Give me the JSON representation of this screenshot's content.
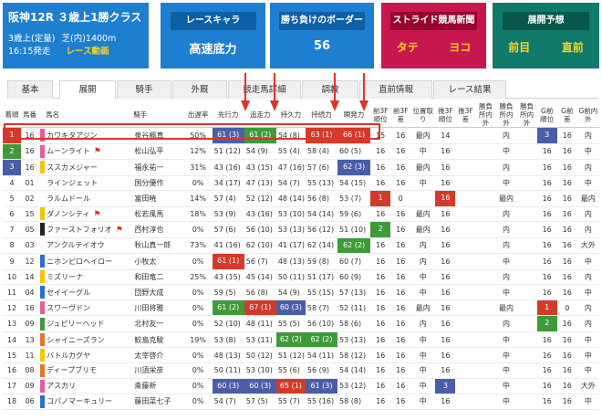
{
  "race_info": {
    "title": "阪神12R ３歳上1勝クラス",
    "condition": "3歳上(定量)",
    "course": "芝(内)1400m",
    "time": "16:15発走",
    "video": "レース動画"
  },
  "boxes": {
    "race_chara": {
      "caption": "レースキャラ",
      "value": "高速底力"
    },
    "border": {
      "caption": "勝ち負けのボーダー",
      "value": "56"
    },
    "stride": {
      "caption": "ストライド競馬新聞",
      "a": "タテ",
      "b": "ヨコ"
    },
    "forecast": {
      "caption": "展開予想",
      "a": "前目",
      "b": "直前"
    }
  },
  "tabs": [
    "基本",
    "展開",
    "騎手",
    "外厩",
    "競走馬詳細",
    "調教",
    "直前情報",
    "レース結果"
  ],
  "active_tab": "展開",
  "headers": [
    "着順",
    "馬番",
    "",
    "馬名",
    "騎手",
    "出遅率",
    "先行力",
    "追走力",
    "持久力",
    "持続力",
    "瞬発力",
    "前3F順位",
    "前3F差",
    "位置取り",
    "後3F順位",
    "後3F差",
    "勝負所内外",
    "勝負所内外",
    "勝負所内外",
    "G前順位",
    "G前差",
    "G前内外"
  ],
  "colors": {
    "red": "#d23b2a",
    "green": "#3f9a3c",
    "blue": "#4a5ea8",
    "highlight": "#e0322b"
  },
  "rows": [
    {
      "rank": "1",
      "rank_color": "red",
      "num": "16",
      "band": "#e85a9a",
      "name": "カワキタアジン",
      "flag": "",
      "jockey": "泉谷楓真",
      "delay": "50%",
      "s": [
        [
          "61 (3)",
          "bl"
        ],
        [
          "61 (2)",
          "gr"
        ],
        [
          "54 (8)",
          ""
        ],
        [
          "63 (1)",
          "rd"
        ],
        [
          "66 (1)",
          "rd"
        ]
      ],
      "f3o": "15",
      "f3d": "16",
      "pos": "最内",
      "l3o": "14",
      "l3d": "",
      "o1": "",
      "o2": "内",
      "o3": "",
      "go": [
        "3",
        "bl"
      ],
      "gd": "16",
      "gi": "内"
    },
    {
      "rank": "2",
      "rank_color": "green",
      "num": "16",
      "band": "#e85a9a",
      "name": "ムーンライト",
      "flag": "⚑",
      "jockey": "松山弘平",
      "delay": "12%",
      "s": [
        [
          "51 (12)",
          ""
        ],
        [
          "54 (9)",
          ""
        ],
        [
          "55 (4)",
          ""
        ],
        [
          "58 (4)",
          ""
        ],
        [
          "60 (5)",
          ""
        ]
      ],
      "f3o": "16",
      "f3d": "16",
      "pos": "中",
      "l3o": "16",
      "l3d": "",
      "o1": "",
      "o2": "中",
      "o3": "",
      "go": [
        "16",
        ""
      ],
      "gd": "16",
      "gi": "中"
    },
    {
      "rank": "3",
      "rank_color": "blue",
      "num": "16",
      "band": "#f3c400",
      "name": "ススカメジャー",
      "flag": "",
      "jockey": "福永祐一",
      "delay": "31%",
      "s": [
        [
          "43 (16)",
          ""
        ],
        [
          "43 (15)",
          ""
        ],
        [
          "47 (16)",
          ""
        ],
        [
          "57 (6)",
          ""
        ],
        [
          "62 (3)",
          "bl"
        ]
      ],
      "f3o": "16",
      "f3d": "16",
      "pos": "最内",
      "l3o": "16",
      "l3d": "",
      "o1": "",
      "o2": "内",
      "o3": "",
      "go": [
        "16",
        ""
      ],
      "gd": "16",
      "gi": "内"
    },
    {
      "rank": "4",
      "rank_color": "",
      "num": "01",
      "band": "#ffffff",
      "name": "ラインジェット",
      "flag": "",
      "jockey": "国分優作",
      "delay": "0%",
      "s": [
        [
          "34 (17)",
          ""
        ],
        [
          "47 (13)",
          ""
        ],
        [
          "54 (7)",
          ""
        ],
        [
          "55 (13)",
          ""
        ],
        [
          "54 (15)",
          ""
        ]
      ],
      "f3o": "16",
      "f3d": "16",
      "pos": "中",
      "l3o": "16",
      "l3d": "",
      "o1": "",
      "o2": "中",
      "o3": "",
      "go": [
        "16",
        ""
      ],
      "gd": "16",
      "gi": "中"
    },
    {
      "rank": "5",
      "rank_color": "",
      "num": "02",
      "band": "#ffffff",
      "name": "ラルムドール",
      "flag": "",
      "jockey": "富田暁",
      "delay": "14%",
      "s": [
        [
          "57 (4)",
          ""
        ],
        [
          "52 (12)",
          ""
        ],
        [
          "48 (14)",
          ""
        ],
        [
          "56 (8)",
          ""
        ],
        [
          "53 (7)",
          ""
        ]
      ],
      "f3o": [
        "1",
        "rd"
      ],
      "f3d": "0",
      "pos": "",
      "l3o": [
        "16",
        "rd"
      ],
      "l3d": "",
      "o1": "",
      "o2": "最内",
      "o3": "",
      "go": [
        "16",
        ""
      ],
      "gd": "16",
      "gi": "最内"
    },
    {
      "rank": "6",
      "rank_color": "",
      "num": "15",
      "band": "#f3c400",
      "name": "ダノンシティ",
      "flag": "⚑",
      "jockey": "松若風馬",
      "delay": "18%",
      "s": [
        [
          "53 (9)",
          ""
        ],
        [
          "43 (16)",
          ""
        ],
        [
          "53 (10)",
          ""
        ],
        [
          "54 (14)",
          ""
        ],
        [
          "59 (6)",
          ""
        ]
      ],
      "f3o": "16",
      "f3d": "16",
      "pos": "最内",
      "l3o": "16",
      "l3d": "",
      "o1": "",
      "o2": "内",
      "o3": "",
      "go": [
        "16",
        ""
      ],
      "gd": "16",
      "gi": "内"
    },
    {
      "rank": "7",
      "rank_color": "",
      "num": "05",
      "band": "#222222",
      "name": "ファーストフォリオ",
      "flag": "⚑",
      "jockey": "西村淳也",
      "delay": "0%",
      "s": [
        [
          "57 (6)",
          ""
        ],
        [
          "56 (10)",
          ""
        ],
        [
          "53 (13)",
          ""
        ],
        [
          "56 (12)",
          ""
        ],
        [
          "51 (10)",
          ""
        ]
      ],
      "f3o": [
        "2",
        "gr"
      ],
      "f3d": "16",
      "pos": "最内",
      "l3o": "16",
      "l3d": "",
      "o1": "",
      "o2": "内",
      "o3": "",
      "go": [
        "16",
        ""
      ],
      "gd": "16",
      "gi": "内"
    },
    {
      "rank": "8",
      "rank_color": "",
      "num": "03",
      "band": "#ffffff",
      "name": "アンクルテイオウ",
      "flag": "",
      "jockey": "秋山真一郎",
      "delay": "73%",
      "s": [
        [
          "41 (16)",
          ""
        ],
        [
          "62 (10)",
          ""
        ],
        [
          "41 (17)",
          ""
        ],
        [
          "62 (14)",
          ""
        ],
        [
          "62 (2)",
          "gr"
        ]
      ],
      "f3o": "16",
      "f3d": "16",
      "pos": "内",
      "l3o": "16",
      "l3d": "",
      "o1": "",
      "o2": "内",
      "o3": "",
      "go": [
        "16",
        ""
      ],
      "gd": "16",
      "gi": "大外"
    },
    {
      "rank": "9",
      "rank_color": "",
      "num": "12",
      "band": "#2a6ed0",
      "name": "ニホンピロヘイロー",
      "flag": "",
      "jockey": "小牧太",
      "delay": "0%",
      "s": [
        [
          "61 (1)",
          "rd"
        ],
        [
          "56 (7)",
          ""
        ],
        [
          "48 (13)",
          ""
        ],
        [
          "59 (8)",
          ""
        ],
        [
          "60 (7)",
          ""
        ]
      ],
      "f3o": "16",
      "f3d": "16",
      "pos": "内",
      "l3o": "16",
      "l3d": "",
      "o1": "",
      "o2": "中",
      "o3": "",
      "go": [
        "16",
        ""
      ],
      "gd": "16",
      "gi": "中"
    },
    {
      "rank": "10",
      "rank_color": "",
      "num": "14",
      "band": "#f3c400",
      "name": "ミズリーナ",
      "flag": "",
      "jockey": "和田竜二",
      "delay": "25%",
      "s": [
        [
          "43 (15)",
          ""
        ],
        [
          "45 (14)",
          ""
        ],
        [
          "50 (11)",
          ""
        ],
        [
          "51 (17)",
          ""
        ],
        [
          "60 (9)",
          ""
        ]
      ],
      "f3o": "16",
      "f3d": "16",
      "pos": "中",
      "l3o": "16",
      "l3d": "",
      "o1": "",
      "o2": "内",
      "o3": "",
      "go": [
        "16",
        ""
      ],
      "gd": "16",
      "gi": "内"
    },
    {
      "rank": "11",
      "rank_color": "",
      "num": "04",
      "band": "#2a6ed0",
      "name": "セイイーグル",
      "flag": "",
      "jockey": "団野大成",
      "delay": "0%",
      "s": [
        [
          "59 (5)",
          ""
        ],
        [
          "56 (8)",
          ""
        ],
        [
          "54 (9)",
          ""
        ],
        [
          "55 (15)",
          ""
        ],
        [
          "57 (13)",
          ""
        ]
      ],
      "f3o": "16",
      "f3d": "16",
      "pos": "中",
      "l3o": "16",
      "l3d": "",
      "o1": "",
      "o2": "中",
      "o3": "",
      "go": [
        "16",
        ""
      ],
      "gd": "16",
      "gi": "中"
    },
    {
      "rank": "12",
      "rank_color": "",
      "num": "16",
      "band": "#e85a9a",
      "name": "スワーヴドン",
      "flag": "",
      "jockey": "川田将雅",
      "delay": "0%",
      "s": [
        [
          "61 (2)",
          "gr"
        ],
        [
          "67 (1)",
          "rd"
        ],
        [
          "60 (3)",
          "bl"
        ],
        [
          "58 (7)",
          ""
        ],
        [
          "52 (11)",
          ""
        ]
      ],
      "f3o": "16",
      "f3d": "16",
      "pos": "最内",
      "l3o": "16",
      "l3d": "",
      "o1": "",
      "o2": "最内",
      "o3": "",
      "go": [
        "1",
        "rd"
      ],
      "gd": "0",
      "gi": "内"
    },
    {
      "rank": "13",
      "rank_color": "",
      "num": "09",
      "band": "#3f9a3c",
      "name": "ジュピリーヘッド",
      "flag": "",
      "jockey": "北村友一",
      "delay": "0%",
      "s": [
        [
          "52 (10)",
          ""
        ],
        [
          "48 (11)",
          ""
        ],
        [
          "55 (5)",
          ""
        ],
        [
          "56 (10)",
          ""
        ],
        [
          "58 (6)",
          ""
        ]
      ],
      "f3o": "16",
      "f3d": "16",
      "pos": "内",
      "l3o": "16",
      "l3d": "",
      "o1": "",
      "o2": "内",
      "o3": "",
      "go": [
        "2",
        "gr"
      ],
      "gd": "16",
      "gi": "内"
    },
    {
      "rank": "14",
      "rank_color": "",
      "num": "13",
      "band": "#e2772a",
      "name": "シャイニーズラン",
      "flag": "",
      "jockey": "鮫島克駿",
      "delay": "19%",
      "s": [
        [
          "53 (8)",
          ""
        ],
        [
          "53 (11)",
          ""
        ],
        [
          "62 (2)",
          "gr"
        ],
        [
          "62 (2)",
          "gr"
        ],
        [
          "53 (13)",
          ""
        ]
      ],
      "f3o": "16",
      "f3d": "16",
      "pos": "中",
      "l3o": "16",
      "l3d": "",
      "o1": "",
      "o2": "中",
      "o3": "",
      "go": [
        "16",
        ""
      ],
      "gd": "16",
      "gi": "中"
    },
    {
      "rank": "15",
      "rank_color": "",
      "num": "11",
      "band": "#f3c400",
      "name": "バトルカグヤ",
      "flag": "",
      "jockey": "太宰啓介",
      "delay": "0%",
      "s": [
        [
          "48 (13)",
          ""
        ],
        [
          "50 (12)",
          ""
        ],
        [
          "51 (12)",
          ""
        ],
        [
          "54 (11)",
          ""
        ],
        [
          "58 (12)",
          ""
        ]
      ],
      "f3o": "16",
      "f3d": "16",
      "pos": "中",
      "l3o": "16",
      "l3d": "",
      "o1": "",
      "o2": "中",
      "o3": "",
      "go": [
        "16",
        ""
      ],
      "gd": "16",
      "gi": "中"
    },
    {
      "rank": "16",
      "rank_color": "",
      "num": "08",
      "band": "#e2772a",
      "name": "ディープブリモ",
      "flag": "",
      "jockey": "川須栄彦",
      "delay": "0%",
      "s": [
        [
          "50 (11)",
          ""
        ],
        [
          "53 (10)",
          ""
        ],
        [
          "55 (6)",
          ""
        ],
        [
          "56 (9)",
          ""
        ],
        [
          "54 (14)",
          ""
        ]
      ],
      "f3o": "16",
      "f3d": "16",
      "pos": "中",
      "l3o": "16",
      "l3d": "",
      "o1": "",
      "o2": "中",
      "o3": "",
      "go": [
        "16",
        ""
      ],
      "gd": "16",
      "gi": "中"
    },
    {
      "rank": "17",
      "rank_color": "",
      "num": "09",
      "band": "#e85a9a",
      "name": "アスカリ",
      "flag": "",
      "jockey": "斎藤新",
      "delay": "0%",
      "s": [
        [
          "60 (3)",
          "bl"
        ],
        [
          "60 (3)",
          "bl"
        ],
        [
          "65 (1)",
          "rd"
        ],
        [
          "61 (3)",
          "bl"
        ],
        [
          "53 (12)",
          ""
        ]
      ],
      "f3o": "16",
      "f3d": "16",
      "pos": "中",
      "l3o": [
        "3",
        "bl"
      ],
      "l3d": "",
      "o1": "",
      "o2": "中",
      "o3": "",
      "go": [
        "16",
        ""
      ],
      "gd": "16",
      "gi": "大外"
    },
    {
      "rank": "18",
      "rank_color": "",
      "num": "06",
      "band": "#2a6ed0",
      "name": "コパノマーキュリー",
      "flag": "",
      "jockey": "藤田菜七子",
      "delay": "0%",
      "s": [
        [
          "54 (7)",
          ""
        ],
        [
          "57 (5)",
          ""
        ],
        [
          "55 (7)",
          ""
        ],
        [
          "55 (16)",
          ""
        ],
        [
          "58 (8)",
          ""
        ]
      ],
      "f3o": "16",
      "f3d": "16",
      "pos": "中",
      "l3o": "16",
      "l3d": "",
      "o1": "",
      "o2": "中",
      "o3": "",
      "go": [
        "16",
        ""
      ],
      "gd": "16",
      "gi": "中"
    }
  ]
}
